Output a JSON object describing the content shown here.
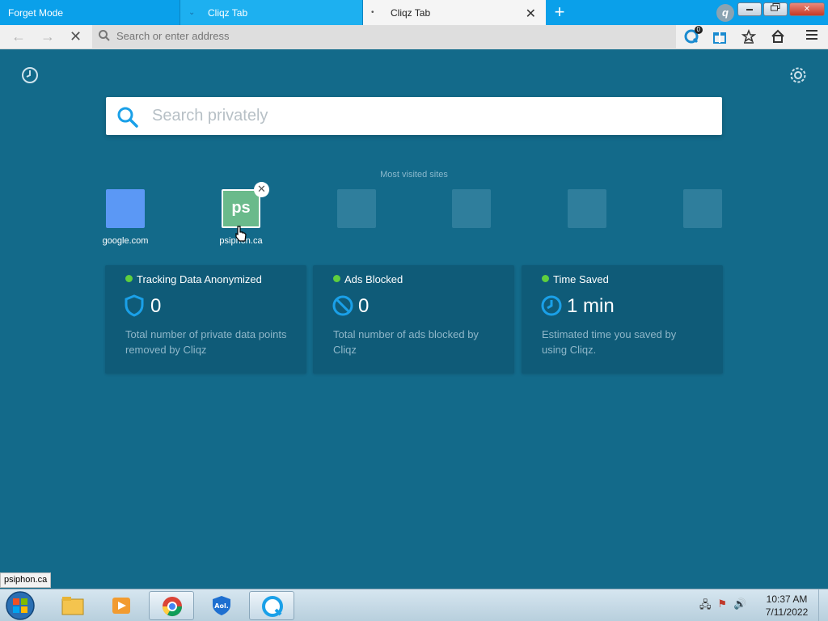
{
  "tabs": {
    "forget_label": "Forget Mode",
    "items": [
      {
        "label": "Cliqz Tab",
        "active": false
      },
      {
        "label": "Cliqz Tab",
        "active": true
      }
    ],
    "new_tab_symbol": "+",
    "close_symbol": "✕"
  },
  "window_controls": {
    "minimize": "▭",
    "maximize": "❐",
    "close": "✕"
  },
  "navbar": {
    "address_placeholder": "Search or enter address",
    "badge_count": "0",
    "icons": [
      "back-icon",
      "forward-icon",
      "stop-icon",
      "cliqz-icon",
      "gift-icon",
      "bookmarks-icon",
      "home-icon",
      "menu-icon"
    ]
  },
  "main": {
    "search_placeholder": "Search privately",
    "most_visited_title": "Most visited sites",
    "tiles": [
      {
        "label": "google.com",
        "logo": ""
      },
      {
        "label": "psiphon.ca",
        "logo": "ps"
      },
      {
        "label": "",
        "logo": ""
      },
      {
        "label": "",
        "logo": ""
      },
      {
        "label": "",
        "logo": ""
      },
      {
        "label": "",
        "logo": ""
      }
    ],
    "cards": [
      {
        "title": "Tracking Data Anonymized",
        "value": "0",
        "description": "Total number of private data points removed by Cliqz",
        "icon": "shield-icon"
      },
      {
        "title": "Ads Blocked",
        "value": "0",
        "description": "Total number of ads blocked by Cliqz",
        "icon": "block-icon"
      },
      {
        "title": "Time Saved",
        "value": "1 min",
        "description": "Estimated time you saved by using Cliqz.",
        "icon": "clock-icon"
      }
    ]
  },
  "status_tooltip": "psiphon.ca",
  "taskbar": {
    "time": "10:37 AM",
    "date": "7/11/2022"
  },
  "colors": {
    "background": "#136a8a",
    "card": "#0f5b78",
    "accent": "#1aa0e8",
    "green_dot": "#5fcf3e",
    "tabbar": "#0aa0ea"
  }
}
